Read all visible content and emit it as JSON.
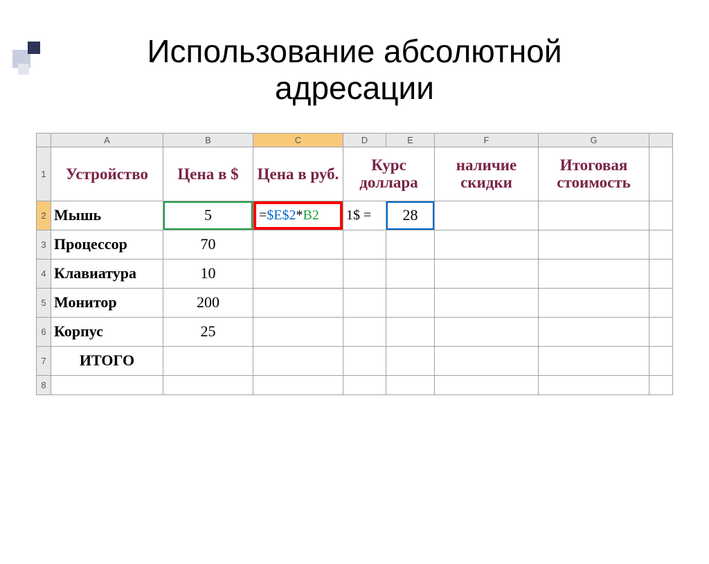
{
  "title_line1": "Использование абсолютной",
  "title_line2": "адресации",
  "columns": [
    "A",
    "B",
    "C",
    "D",
    "E",
    "F",
    "G"
  ],
  "row_numbers": [
    "1",
    "2",
    "3",
    "4",
    "5",
    "6",
    "7",
    "8"
  ],
  "headers": {
    "A": "Устройство",
    "B": "Цена в $",
    "C": "Цена в руб.",
    "DE": "Курс доллара",
    "F": "наличие скидки",
    "G": "Итоговая стоимость"
  },
  "rows": [
    {
      "name": "Мышь",
      "price": "5"
    },
    {
      "name": "Процессор",
      "price": "70"
    },
    {
      "name": "Клавиатура",
      "price": "10"
    },
    {
      "name": "Монитор",
      "price": "200"
    },
    {
      "name": "Корпус",
      "price": "25"
    }
  ],
  "total_label": "ИТОГО",
  "formula": {
    "eq": "=",
    "abs": "$E$2",
    "star": "*",
    "rel": "B2"
  },
  "rate_label": "1$ =",
  "rate_value": "28",
  "active_col": "C",
  "active_row": "2"
}
